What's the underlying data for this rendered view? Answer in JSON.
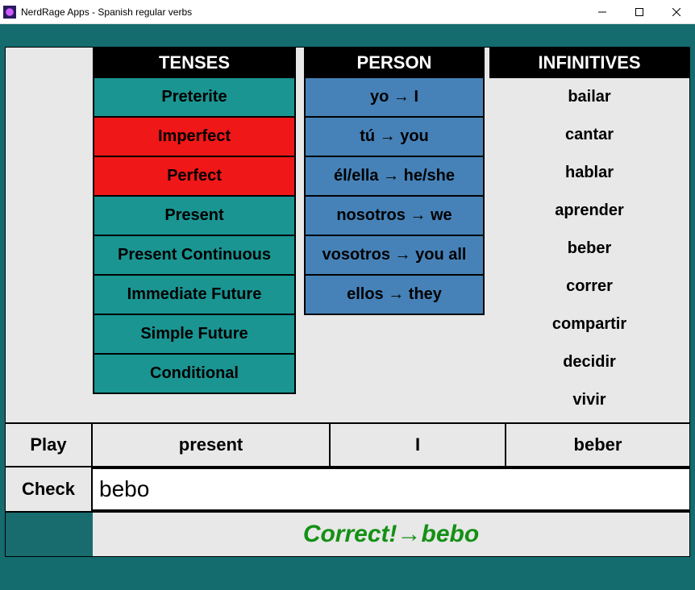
{
  "window": {
    "title": "NerdRage Apps - Spanish regular verbs"
  },
  "headers": {
    "tenses": "TENSES",
    "person": "PERSON",
    "infinitives": "INFINITIVES"
  },
  "tenses": [
    {
      "label": "Preterite",
      "color": "teal"
    },
    {
      "label": "Imperfect",
      "color": "red"
    },
    {
      "label": "Perfect",
      "color": "red"
    },
    {
      "label": "Present",
      "color": "teal"
    },
    {
      "label": "Present Continuous",
      "color": "teal"
    },
    {
      "label": "Immediate Future",
      "color": "teal"
    },
    {
      "label": "Simple Future",
      "color": "teal"
    },
    {
      "label": "Conditional",
      "color": "teal"
    }
  ],
  "persons": [
    {
      "label": "yo → I"
    },
    {
      "label": "tú → you"
    },
    {
      "label": "él/ella → he/she"
    },
    {
      "label": "nosotros → we"
    },
    {
      "label": "vosotros → you all"
    },
    {
      "label": "ellos → they"
    }
  ],
  "infinitives": [
    "bailar",
    "cantar",
    "hablar",
    "aprender",
    "beber",
    "correr",
    "compartir",
    "decidir",
    "vivir"
  ],
  "play": {
    "button": "Play",
    "tense": "present",
    "person": "I",
    "verb": "beber"
  },
  "check": {
    "button": "Check",
    "input_value": "bebo"
  },
  "result": {
    "text": "Correct!→bebo",
    "color": "#149014"
  }
}
